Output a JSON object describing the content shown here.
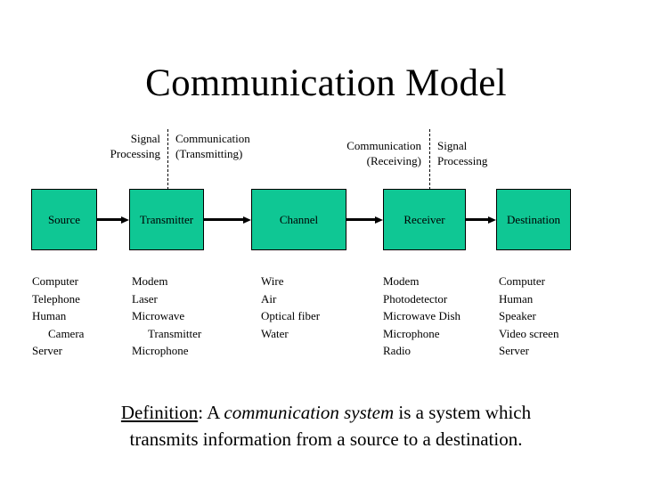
{
  "slide": {
    "title": "Communication Model",
    "background_color": "#ffffff",
    "box_fill_color": "#0fc794",
    "box_border_color": "#000000",
    "text_color": "#000000"
  },
  "phases": {
    "signal_processing_left": "Signal\nProcessing",
    "signal_processing_left_line1": "Signal",
    "signal_processing_left_line2": "Processing",
    "communication_transmitting_line1": "Communication",
    "communication_transmitting_line2": "(Transmitting)",
    "communication_receiving_line1": "Communication",
    "communication_receiving_line2": "(Receiving)",
    "signal_processing_right_line1": "Signal",
    "signal_processing_right_line2": "Processing"
  },
  "stages": {
    "source": "Source",
    "transmitter": "Transmitter",
    "channel": "Channel",
    "receiver": "Receiver",
    "destination": "Destination"
  },
  "examples": {
    "source": [
      "Computer",
      "Telephone",
      "Human",
      "Camera",
      "Server"
    ],
    "transmitter": [
      "Modem",
      "Laser",
      "Microwave",
      "Transmitter",
      "Microphone"
    ],
    "channel": [
      "Wire",
      "Air",
      "Optical fiber",
      "Water"
    ],
    "receiver": [
      "Modem",
      "Photodetector",
      "Microwave  Dish",
      "Microphone",
      "Radio"
    ],
    "destination": [
      "Computer",
      "Human",
      "Speaker",
      "Video screen",
      "Server"
    ]
  },
  "definition": {
    "term": "Definition",
    "colon": ": A ",
    "emphasis": "communication system",
    "rest_line1": " is a system which",
    "line2": "transmits information from a source to a destination."
  }
}
